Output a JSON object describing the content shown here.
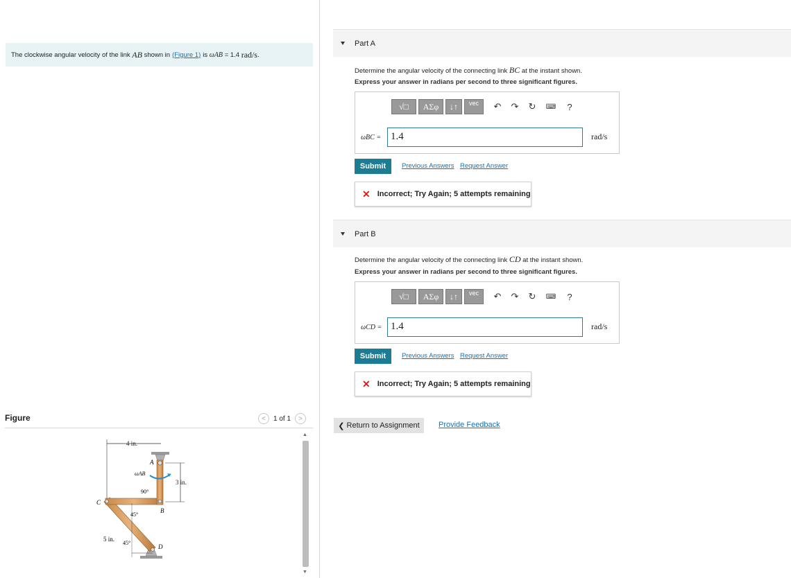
{
  "intro": {
    "text_before": "The clockwise angular velocity of the link",
    "link_name": "AB",
    "shown_in": "shown in",
    "figure_link": "(Figure 1)",
    "is": "is",
    "omega_label": "ωAB",
    "omega_value": "= 1.4",
    "unit": "rad/s",
    "period": "."
  },
  "figure": {
    "title": "Figure",
    "pager": "1 of 1",
    "labels": {
      "dim_top": "4 in.",
      "dim_right": "3 in.",
      "dim_bottom": "5 in.",
      "A": "A",
      "B": "B",
      "C": "C",
      "D": "D",
      "omega": "ωAB",
      "angle_90": "90°",
      "angle_45a": "45°",
      "angle_45b": "45°"
    }
  },
  "parts": [
    {
      "title": "Part A",
      "question_before": "Determine the angular velocity of the connecting link",
      "link": "BC",
      "question_after": "at the instant shown.",
      "instruction": "Express your answer in radians per second to three significant figures.",
      "answer_label": "ωBC =",
      "answer_value": "1.4",
      "unit": "rad/s",
      "submit": "Submit",
      "prev_answers": "Previous Answers",
      "request_answer": "Request Answer",
      "feedback": "Incorrect; Try Again; 5 attempts remaining"
    },
    {
      "title": "Part B",
      "question_before": "Determine the angular velocity of the connecting link",
      "link": "CD",
      "question_after": "at the instant shown.",
      "instruction": "Express your answer in radians per second to three significant figures.",
      "answer_label": "ωCD =",
      "answer_value": "1.4",
      "unit": "rad/s",
      "submit": "Submit",
      "prev_answers": "Previous Answers",
      "request_answer": "Request Answer",
      "feedback": "Incorrect; Try Again; 5 attempts remaining"
    }
  ],
  "toolbar": {
    "templates": "√□",
    "symbols": "ΑΣφ",
    "arrows": "↓↑",
    "vec": "vec",
    "undo": "↶",
    "redo": "↷",
    "reset": "↻",
    "keyboard": "⌨",
    "help": "?"
  },
  "footer": {
    "return": "Return to Assignment",
    "feedback": "Provide Feedback"
  }
}
